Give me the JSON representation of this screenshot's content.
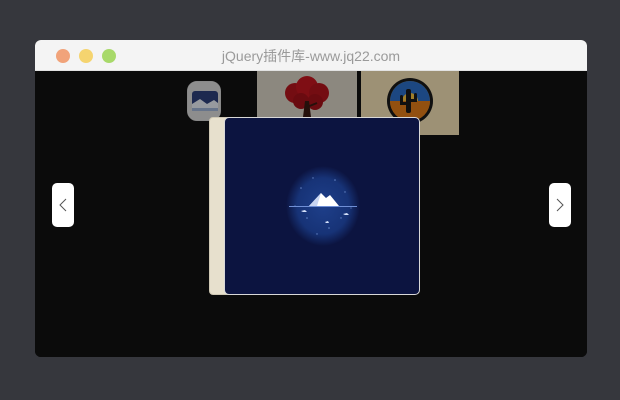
{
  "window": {
    "title": "jQuery插件库-www.jq22.com"
  },
  "carousel": {
    "thumbnails": [
      {
        "icon": "landscape-badge-icon"
      },
      {
        "icon": "bonsai-tree-icon"
      },
      {
        "icon": "desert-cactus-icon"
      }
    ],
    "active_slide": {
      "icon": "mountain-sea-icon"
    },
    "prev_icon": "chevron-left-icon",
    "next_icon": "chevron-right-icon"
  },
  "colors": {
    "page_background": "#36373d",
    "titlebar": "#f4f4f4",
    "stage": "#0b0b0b",
    "active_slide_background": "#0c1440",
    "traffic_red": "#f1a37a",
    "traffic_yellow": "#f5d46f",
    "traffic_green": "#a8d96a"
  }
}
